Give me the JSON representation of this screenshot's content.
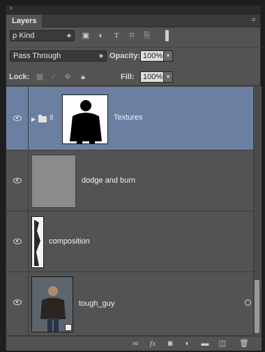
{
  "panel": {
    "close_glyph": "×",
    "tab_label": "Layers",
    "menu_glyph": "≡"
  },
  "filter": {
    "kind_label": "ρ Kind",
    "icons": [
      "pixel-filter-icon",
      "adjustment-filter-icon",
      "type-filter-icon",
      "shape-filter-icon",
      "smart-object-filter-icon"
    ]
  },
  "blend": {
    "mode": "Pass Through",
    "opacity_label": "Opacity:",
    "opacity_value": "100%"
  },
  "lock": {
    "label": "Lock:",
    "fill_label": "Fill:",
    "fill_value": "100%"
  },
  "layers": [
    {
      "name": "Textures",
      "type": "group",
      "selected": true
    },
    {
      "name": "dodge and burn",
      "type": "pixel",
      "selected": false
    },
    {
      "name": "composition",
      "type": "pixel",
      "selected": false
    },
    {
      "name": "tough_guy",
      "type": "smart-object",
      "selected": false
    }
  ],
  "bottom_icons": [
    "link-layers-icon",
    "fx-icon",
    "add-mask-icon",
    "adjustment-layer-icon",
    "new-group-icon",
    "new-layer-icon",
    "trash-icon"
  ],
  "colors": {
    "panel_bg": "#535353",
    "selected_row": "#6b7fa3",
    "dark_bg": "#1e1e1e"
  }
}
